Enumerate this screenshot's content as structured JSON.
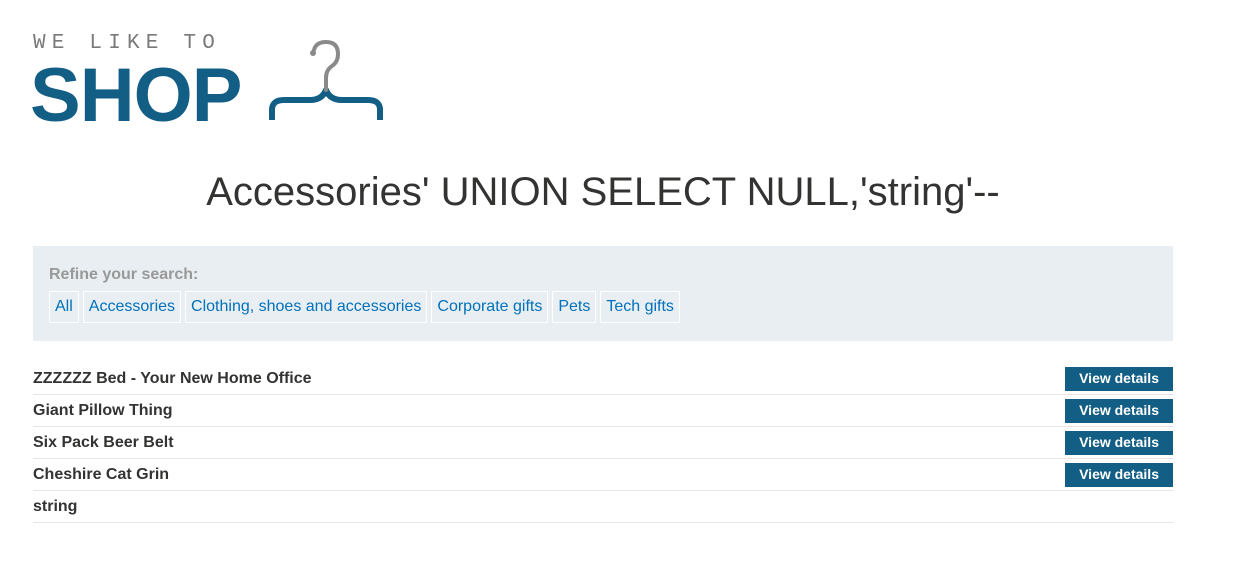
{
  "logo": {
    "tagline": "WE LIKE TO",
    "wordmark": "SHOP",
    "icon": "hanger-icon"
  },
  "title": "Accessories' UNION SELECT NULL,'string'--",
  "filter": {
    "label": "Refine your search:",
    "links": [
      "All",
      "Accessories",
      "Clothing, shoes and accessories",
      "Corporate gifts",
      "Pets",
      "Tech gifts"
    ]
  },
  "results": [
    {
      "name": "ZZZZZZ Bed - Your New Home Office",
      "button": "View details"
    },
    {
      "name": "Giant Pillow Thing",
      "button": "View details"
    },
    {
      "name": "Six Pack Beer Belt",
      "button": "View details"
    },
    {
      "name": "Cheshire Cat Grin",
      "button": "View details"
    },
    {
      "name": "string",
      "button": null
    }
  ],
  "colors": {
    "brand": "#135e84",
    "link": "#0071bc",
    "filter_bg": "#e8eef1"
  }
}
